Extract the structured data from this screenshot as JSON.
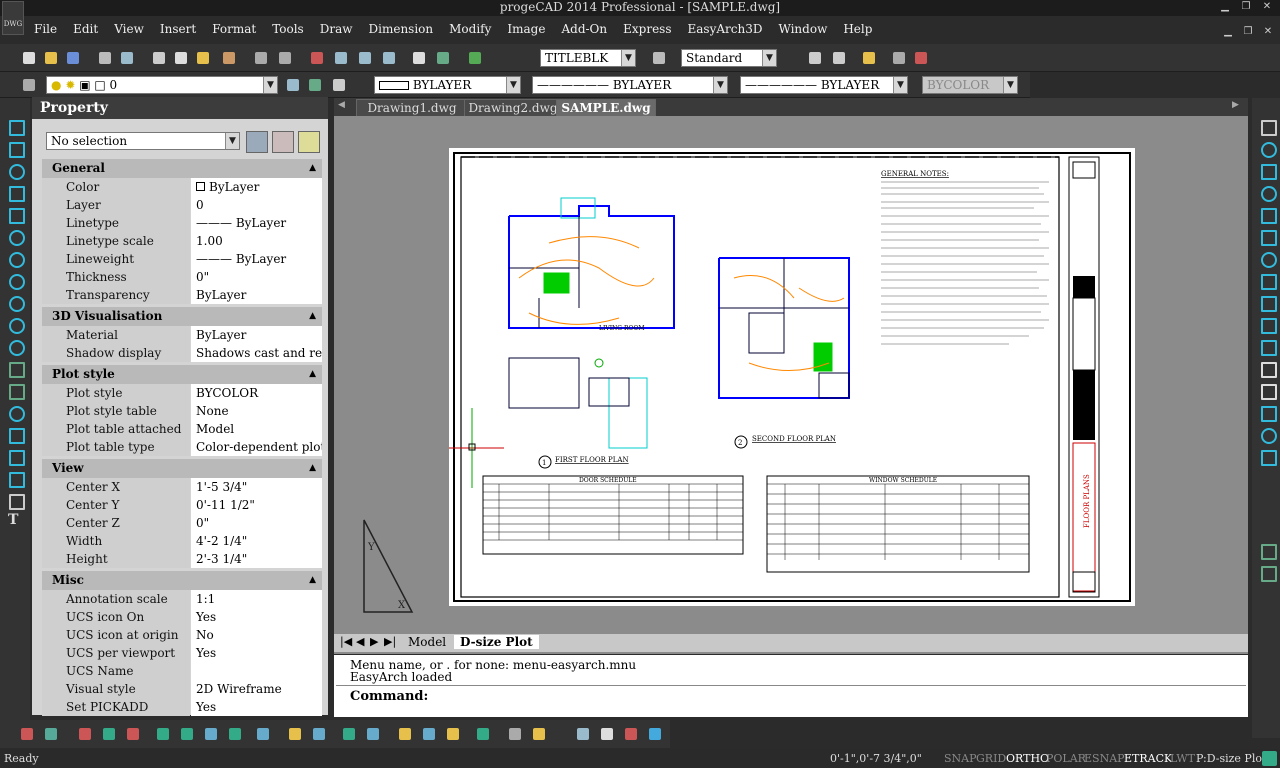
{
  "app": {
    "title": "progeCAD 2014 Professional - [SAMPLE.dwg]",
    "icon_label": "DWG"
  },
  "menu": [
    "File",
    "Edit",
    "View",
    "Insert",
    "Format",
    "Tools",
    "Draw",
    "Dimension",
    "Modify",
    "Image",
    "Add-On",
    "Express",
    "EasyArch3D",
    "Window",
    "Help"
  ],
  "toolbar": {
    "text_style": "TITLEBLK",
    "dim_style": "Standard",
    "layer": "0",
    "color": "BYLAYER",
    "linetype": "BYLAYER",
    "lineweight": "BYLAYER",
    "plotstyle": "BYCOLOR"
  },
  "property": {
    "title": "Property",
    "selection": "No selection",
    "sections": {
      "general": {
        "title": "General",
        "rows": [
          {
            "k": "Color",
            "v": "ByLayer"
          },
          {
            "k": "Layer",
            "v": "0"
          },
          {
            "k": "Linetype",
            "v": "——— ByLayer"
          },
          {
            "k": "Linetype scale",
            "v": "1.00"
          },
          {
            "k": "Lineweight",
            "v": "——— ByLayer"
          },
          {
            "k": "Thickness",
            "v": "0\""
          },
          {
            "k": "Transparency",
            "v": "ByLayer"
          }
        ]
      },
      "vis": {
        "title": "3D Visualisation",
        "rows": [
          {
            "k": "Material",
            "v": "ByLayer"
          },
          {
            "k": "Shadow display",
            "v": "Shadows cast and received"
          }
        ]
      },
      "plot": {
        "title": "Plot style",
        "rows": [
          {
            "k": "Plot style",
            "v": "BYCOLOR"
          },
          {
            "k": "Plot style table",
            "v": "None"
          },
          {
            "k": "Plot table attached to",
            "v": "Model"
          },
          {
            "k": "Plot table type",
            "v": "Color-dependent plot style"
          }
        ]
      },
      "view": {
        "title": "View",
        "rows": [
          {
            "k": "Center X",
            "v": "1'-5 3/4\""
          },
          {
            "k": "Center Y",
            "v": "0'-11 1/2\""
          },
          {
            "k": "Center Z",
            "v": "0\""
          },
          {
            "k": "Width",
            "v": "4'-2 1/4\""
          },
          {
            "k": "Height",
            "v": "2'-3 1/4\""
          }
        ]
      },
      "misc": {
        "title": "Misc",
        "rows": [
          {
            "k": "Annotation scale",
            "v": "1:1"
          },
          {
            "k": "UCS icon On",
            "v": "Yes"
          },
          {
            "k": "UCS icon at origin",
            "v": "No"
          },
          {
            "k": "UCS per viewport",
            "v": "Yes"
          },
          {
            "k": "UCS Name",
            "v": ""
          },
          {
            "k": "Visual style",
            "v": "2D Wireframe"
          },
          {
            "k": "Set PICKADD",
            "v": "Yes"
          }
        ]
      }
    }
  },
  "doc_tabs": [
    "Drawing1.dwg",
    "Drawing2.dwg",
    "SAMPLE.dwg"
  ],
  "layout_tabs": [
    "Model",
    "D-size Plot"
  ],
  "sheet": {
    "first_floor": "FIRST FLOOR PLAN",
    "second_floor": "SECOND FLOOR PLAN",
    "first_num": "1",
    "second_num": "2",
    "door_schedule": "DOOR SCHEDULE",
    "window_schedule": "WINDOW SCHEDULE",
    "general_notes": "GENERAL NOTES:",
    "title_block": "FLOOR PLANS"
  },
  "command": {
    "line1": "Menu name, or . for none: menu-easyarch.mnu",
    "line2": "EasyArch loaded",
    "prompt": "Command:"
  },
  "status": {
    "ready": "Ready",
    "coords": "0'-1\",0'-7 3/4\",0\"",
    "toggles": [
      "SNAP",
      "GRID",
      "ORTHO",
      "POLAR",
      "ESNAP",
      "ETRACK",
      "LWT"
    ],
    "space": "P:D-size Plot"
  }
}
